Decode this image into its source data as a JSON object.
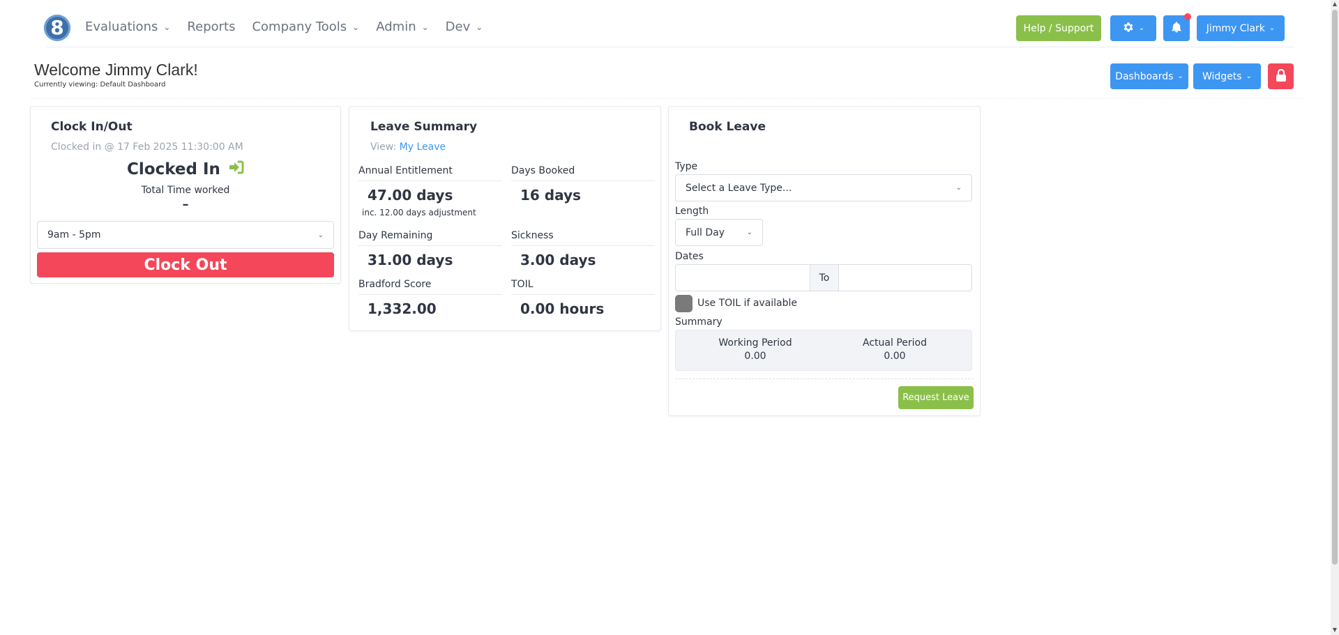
{
  "nav": {
    "logo_text": "8",
    "items": [
      {
        "label": "Evaluations",
        "has_dropdown": true
      },
      {
        "label": "Reports",
        "has_dropdown": false
      },
      {
        "label": "Company Tools",
        "has_dropdown": true
      },
      {
        "label": "Admin",
        "has_dropdown": true
      },
      {
        "label": "Dev",
        "has_dropdown": true
      }
    ],
    "help_label": "Help / Support",
    "user_label": "Jimmy Clark",
    "has_notification": true
  },
  "welcome": {
    "title": "Welcome Jimmy Clark!",
    "subtitle": "Currently viewing: Default Dashboard",
    "dashboards_label": "Dashboards",
    "widgets_label": "Widgets"
  },
  "clock": {
    "title": "Clock In/Out",
    "clocked_in_at": "Clocked in @ 17 Feb 2025 11:30:00 AM",
    "status": "Clocked In",
    "total_time_label": "Total Time worked",
    "total_time_value": "–",
    "shift": "9am - 5pm",
    "clock_out_label": "Clock Out"
  },
  "leave": {
    "title": "Leave Summary",
    "view_prefix": "View:",
    "view_link": "My Leave",
    "stats": [
      {
        "label": "Annual Entitlement",
        "value": "47.00 days",
        "note": "inc. 12.00 days adjustment"
      },
      {
        "label": "Days Booked",
        "value": "16 days"
      },
      {
        "label": "Day Remaining",
        "value": "31.00 days"
      },
      {
        "label": "Sickness",
        "value": "3.00 days"
      },
      {
        "label": "Bradford Score",
        "value": "1,332.00"
      },
      {
        "label": "TOIL",
        "value": "0.00 hours"
      }
    ]
  },
  "book": {
    "title": "Book Leave",
    "type_label": "Type",
    "type_placeholder": "Select a Leave Type...",
    "length_label": "Length",
    "length_value": "Full Day",
    "dates_label": "Dates",
    "to_label": "To",
    "toil_label": "Use TOIL if available",
    "summary_label": "Summary",
    "working_period_label": "Working Period",
    "working_period_value": "0.00",
    "actual_period_label": "Actual Period",
    "actual_period_value": "0.00",
    "request_label": "Request Leave"
  },
  "colors": {
    "primary": "#3d96f2",
    "success": "#8ac04a",
    "danger": "#f4475a"
  }
}
